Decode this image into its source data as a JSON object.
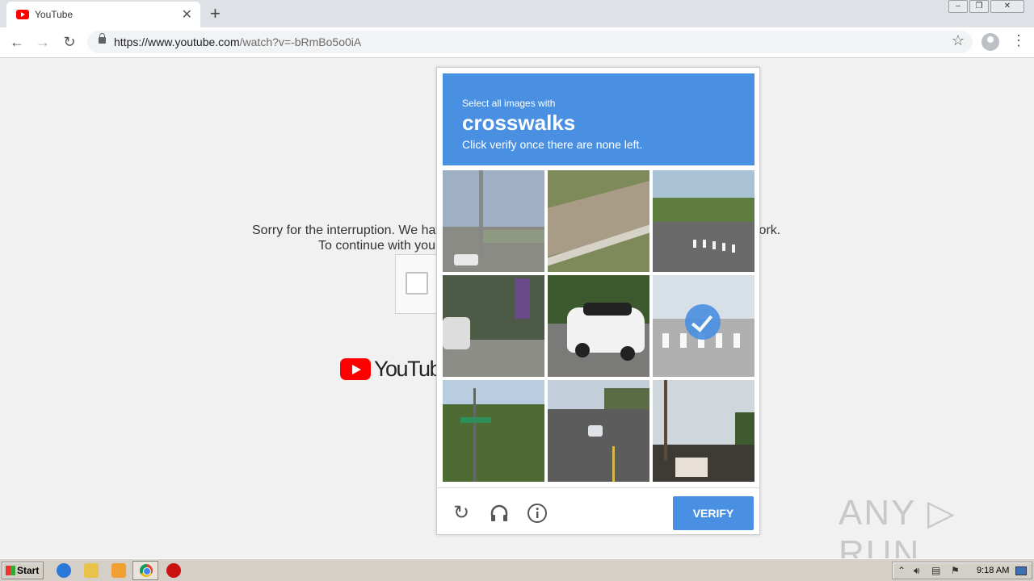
{
  "browser": {
    "tab_title": "YouTube",
    "tab_close": "✕",
    "new_tab": "+",
    "url_host": "https://www.youtube.com",
    "url_path": "/watch?v=-bRmBo5o0iA"
  },
  "page": {
    "sorry_line1_left": "Sorry for the interruption. We have",
    "sorry_line1_right": "work.",
    "sorry_line2_left": "To continue with your",
    "logo_text": "YouTube"
  },
  "challenge": {
    "prompt_small": "Select all images with",
    "prompt_target": "crosswalks",
    "prompt_hint": "Click verify once there are none left.",
    "verify_label": "VERIFY",
    "tiles": [
      {
        "name": "tile-1",
        "sky": "#9fb0c4",
        "ground": "#8b8b86",
        "selected": false
      },
      {
        "name": "tile-2",
        "sky": "#7e8a5a",
        "ground": "#9a8f7f",
        "selected": false
      },
      {
        "name": "tile-3",
        "sky": "#a9c2d6",
        "ground": "#6a6a6a",
        "selected": false
      },
      {
        "name": "tile-4",
        "sky": "#4d5a46",
        "ground": "#8d8d88",
        "selected": false
      },
      {
        "name": "tile-5",
        "sky": "#3d5a2e",
        "ground": "#7a7a78",
        "selected": false
      },
      {
        "name": "tile-6",
        "sky": "#b6c7d3",
        "ground": "#707070",
        "selected": true
      },
      {
        "name": "tile-7",
        "sky": "#b8cde0",
        "ground": "#4e6b34",
        "selected": false
      },
      {
        "name": "tile-8",
        "sky": "#c3d0dc",
        "ground": "#5c5c5c",
        "selected": false
      },
      {
        "name": "tile-9",
        "sky": "#cfd6dc",
        "ground": "#3e3a36",
        "selected": false
      }
    ]
  },
  "watermark": "ANY ▷ RUN",
  "taskbar": {
    "start_label": "Start",
    "clock": "9:18 AM"
  }
}
